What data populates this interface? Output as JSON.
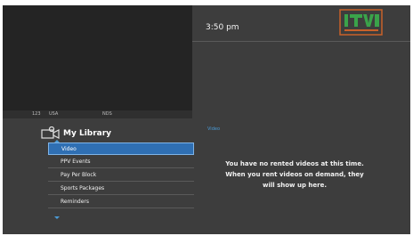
{
  "channel": {
    "number": "123",
    "name": "USA",
    "provider": "NDS"
  },
  "clock": {
    "time": "3:50 pm"
  },
  "logo": {
    "brand_color": "#c8612a",
    "accent_color": "#3aa34a"
  },
  "library": {
    "title": "My Library",
    "icon": "camera-icon",
    "items": [
      {
        "label": "Video",
        "selected": true
      },
      {
        "label": "PPV Events",
        "selected": false
      },
      {
        "label": "Pay Per Block",
        "selected": false
      },
      {
        "label": "Sports Packages",
        "selected": false
      },
      {
        "label": "Reminders",
        "selected": false
      }
    ]
  },
  "content": {
    "section_label": "Video",
    "message_lines": [
      "You have no rented videos at this time.",
      "When you rent videos on demand, they",
      "will show up here."
    ]
  },
  "colors": {
    "selection": "#2f6fb3",
    "accent_blue": "#4a9ad6",
    "background": "#3d3d3d"
  }
}
